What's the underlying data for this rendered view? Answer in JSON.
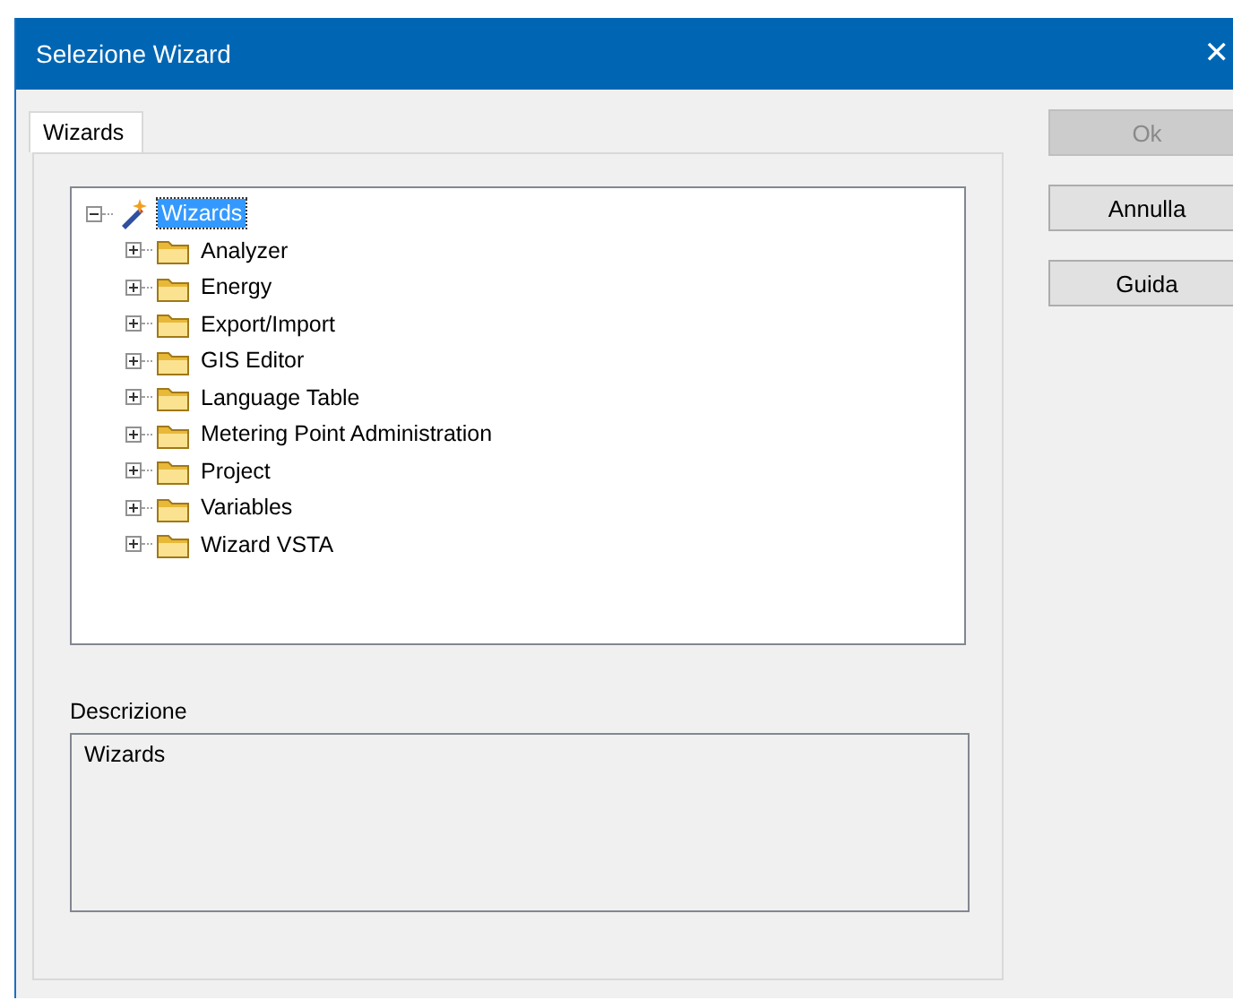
{
  "window": {
    "title": "Selezione Wizard",
    "close": "✕"
  },
  "tabs": [
    {
      "label": "Wizards",
      "selected": true
    }
  ],
  "tree": [
    {
      "label": "Wizards",
      "kind": "root",
      "expanded": true,
      "selected": true,
      "children": [
        {
          "label": "Analyzer",
          "kind": "folder",
          "expanded": false,
          "selected": false
        },
        {
          "label": "Energy",
          "kind": "folder",
          "expanded": false,
          "selected": false
        },
        {
          "label": "Export/Import",
          "kind": "folder",
          "expanded": false,
          "selected": false
        },
        {
          "label": "GIS Editor",
          "kind": "folder",
          "expanded": false,
          "selected": false
        },
        {
          "label": "Language Table",
          "kind": "folder",
          "expanded": false,
          "selected": false
        },
        {
          "label": "Metering Point Administration",
          "kind": "folder",
          "expanded": false,
          "selected": false
        },
        {
          "label": "Project",
          "kind": "folder",
          "expanded": false,
          "selected": false
        },
        {
          "label": "Variables",
          "kind": "folder",
          "expanded": false,
          "selected": false
        },
        {
          "label": "Wizard VSTA",
          "kind": "folder",
          "expanded": false,
          "selected": false
        }
      ]
    }
  ],
  "description": {
    "label": "Descrizione",
    "text": "Wizards"
  },
  "buttons": [
    {
      "label": "Ok",
      "disabled": true
    },
    {
      "label": "Annulla",
      "disabled": false
    },
    {
      "label": "Guida",
      "disabled": false
    }
  ]
}
